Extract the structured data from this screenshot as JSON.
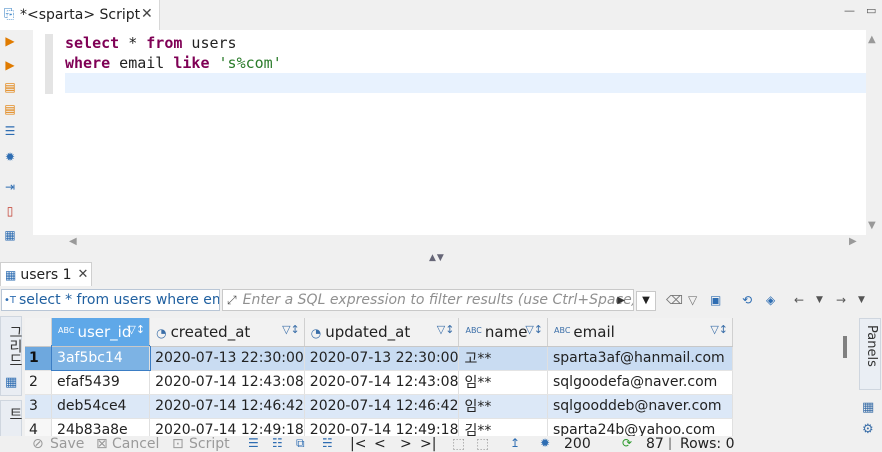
{
  "editor_tab": {
    "title": "*<sparta> Script",
    "close": "✕"
  },
  "window": {
    "minimize": "—",
    "maximize": "▭"
  },
  "editor": {
    "line1": {
      "kw1": "select",
      "plain": " * ",
      "kw2": "from",
      "rest": " users"
    },
    "line2": {
      "kw1": "where",
      "plain": " email ",
      "kw2": "like",
      "space": " ",
      "str": "'s%com'"
    }
  },
  "results_tab": {
    "label": "users 1",
    "close": "✕"
  },
  "filter": {
    "query_text": "select * from users where email like 's%com'",
    "expression_placeholder": "Enter a SQL expression to filter results (use Ctrl+Space)"
  },
  "left_panel": {
    "grid_label": "그리드",
    "text_label": "텍스트"
  },
  "grid": {
    "columns": [
      "user_id",
      "created_at",
      "updated_at",
      "name",
      "email"
    ],
    "column_types": [
      "ABC",
      "clock",
      "clock",
      "ABC",
      "ABC"
    ],
    "rows": [
      {
        "n": "1",
        "user_id": "3af5bc14",
        "created_at": "2020-07-13 22:30:00",
        "updated_at": "2020-07-13 22:30:00",
        "name": "고**",
        "email": "sparta3af@hanmail.com"
      },
      {
        "n": "2",
        "user_id": "efaf5439",
        "created_at": "2020-07-14 12:43:08",
        "updated_at": "2020-07-14 12:43:08",
        "name": "임**",
        "email": "sqlgoodefa@naver.com"
      },
      {
        "n": "3",
        "user_id": "deb54ce4",
        "created_at": "2020-07-14 12:46:42",
        "updated_at": "2020-07-14 12:46:42",
        "name": "임**",
        "email": "sqlgooddeb@naver.com"
      },
      {
        "n": "4",
        "user_id": "24b83a8e",
        "created_at": "2020-07-14 12:49:18",
        "updated_at": "2020-07-14 12:49:18",
        "name": "김**",
        "email": "sparta24b@yahoo.com"
      }
    ]
  },
  "right_panel": {
    "panels_label": "Panels"
  },
  "bottom": {
    "save": "Save",
    "cancel": "Cancel",
    "script": "Script",
    "fetch_size": "200",
    "refresh_count": "87",
    "rows": "Rows: 0"
  }
}
